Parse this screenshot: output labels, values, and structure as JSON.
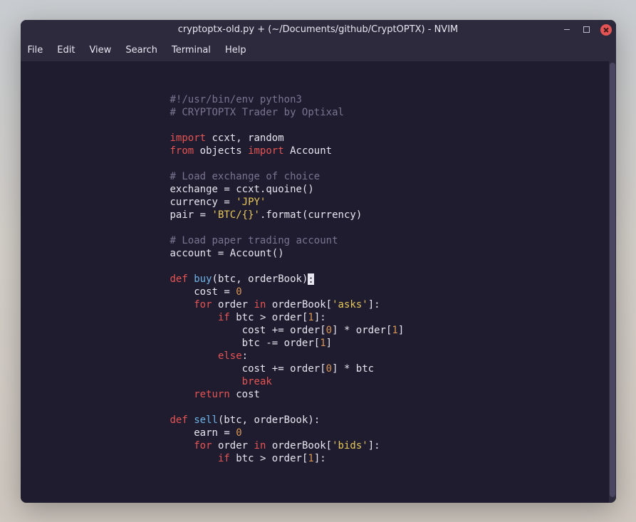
{
  "titlebar": {
    "title": "cryptoptx-old.py + (~/Documents/github/CryptOPTX) - NVIM"
  },
  "menu": {
    "items": [
      "File",
      "Edit",
      "View",
      "Search",
      "Terminal",
      "Help"
    ]
  },
  "code": {
    "l1_comment": "#!/usr/bin/env python3",
    "l2_comment": "# CRYPTOPTX Trader by Optixal",
    "l4_kw": "import",
    "l4_rest": " ccxt, random",
    "l5_kw1": "from",
    "l5_mid": " objects ",
    "l5_kw2": "import",
    "l5_rest": " Account",
    "l7_comment": "# Load exchange of choice",
    "l8": "exchange = ccxt.quoine()",
    "l9_pre": "currency = ",
    "l9_str": "'JPY'",
    "l10_pre": "pair = ",
    "l10_str": "'BTC/{}'",
    "l10_rest": ".format(currency)",
    "l12_comment": "# Load paper trading account",
    "l13": "account = Account()",
    "l15_kw": "def",
    "l15_fn": " buy",
    "l15_rest": "(btc, orderBook)",
    "l15_cursor": ":",
    "l16_pre": "    cost = ",
    "l16_num": "0",
    "l17_pre": "    ",
    "l17_kw1": "for",
    "l17_mid": " order ",
    "l17_kw2": "in",
    "l17_rest1": " orderBook[",
    "l17_str": "'asks'",
    "l17_rest2": "]:",
    "l18_pre": "        ",
    "l18_kw": "if",
    "l18_rest1": " btc > order[",
    "l18_num": "1",
    "l18_rest2": "]:",
    "l19_pre": "            cost += order[",
    "l19_num1": "0",
    "l19_mid": "] * order[",
    "l19_num2": "1",
    "l19_rest": "]",
    "l20_pre": "            btc -= order[",
    "l20_num": "1",
    "l20_rest": "]",
    "l21_pre": "        ",
    "l21_kw": "else",
    "l21_rest": ":",
    "l22_pre": "            cost += order[",
    "l22_num": "0",
    "l22_rest": "] * btc",
    "l23_pre": "            ",
    "l23_kw": "break",
    "l24_pre": "    ",
    "l24_kw": "return",
    "l24_rest": " cost",
    "l26_kw": "def",
    "l26_fn": " sell",
    "l26_rest": "(btc, orderBook):",
    "l27_pre": "    earn = ",
    "l27_num": "0",
    "l28_pre": "    ",
    "l28_kw1": "for",
    "l28_mid": " order ",
    "l28_kw2": "in",
    "l28_rest1": " orderBook[",
    "l28_str": "'bids'",
    "l28_rest2": "]:",
    "l29_pre": "        ",
    "l29_kw": "if",
    "l29_rest1": " btc > order[",
    "l29_num": "1",
    "l29_rest2": "]:"
  }
}
